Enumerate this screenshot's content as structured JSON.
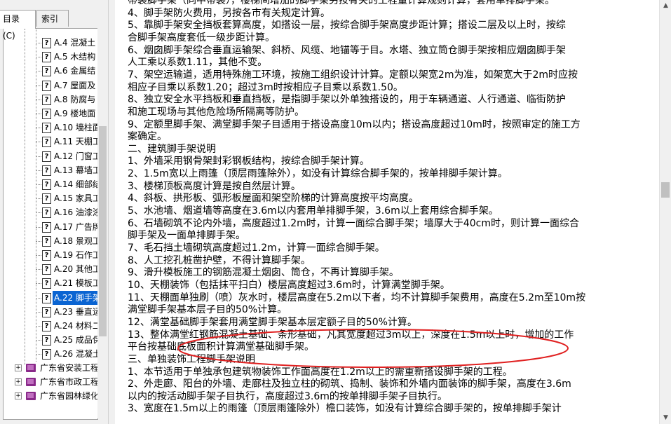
{
  "sidebar": {
    "tabs": {
      "contents": "目录(C)",
      "index": "索引(I)"
    },
    "items": [
      {
        "label": "A.4  混凝土"
      },
      {
        "label": "A.5  木结构"
      },
      {
        "label": "A.6  金属结"
      },
      {
        "label": "A.7  屋面及"
      },
      {
        "label": "A.8  防腐与"
      },
      {
        "label": "A.9  楼地面"
      },
      {
        "label": "A.10  墙柱面"
      },
      {
        "label": "A.11  天棚工"
      },
      {
        "label": "A.12  门窗工"
      },
      {
        "label": "A.13  幕墙工"
      },
      {
        "label": "A.14  细部结"
      },
      {
        "label": "A.15  家具工"
      },
      {
        "label": "A.16  油漆涂"
      },
      {
        "label": "A.17  广告牌"
      },
      {
        "label": "A.18  景观工"
      },
      {
        "label": "A.19  石作工"
      },
      {
        "label": "A.20  其他工"
      },
      {
        "label": "A.21  模板工"
      },
      {
        "label": "A.22  脚手架"
      },
      {
        "label": "A.23  垂直运"
      },
      {
        "label": "A.24  材料二"
      },
      {
        "label": "A.25  成品保"
      },
      {
        "label": "A.26  混凝土"
      }
    ],
    "books": [
      {
        "label": "广东省安装工程"
      },
      {
        "label": "广东省市政工程"
      },
      {
        "label": "广东省园林绿化"
      }
    ]
  },
  "content": {
    "lines": [
      "帯装脚手架（同中帯装），楼梯间增加的脚手架另按有关的工程量计算规则计算，套用单排脚手架。",
      "    4、脚手架防火费用，另按各市有关规定计算。",
      "    5、靠脚手架安全挡板套算高度，如搭设一层，按综合脚手架高度步距计算；搭设二层及以上时，按综",
      "合脚手架高度套低一级步距计算。",
      "    6、烟囱脚手架综合垂直运输架、斜桥、风缆、地锚等于目。水塔、独立筒仓脚手架按相应烟囱脚手架",
      "人工乘以系数1.11，其他不变。",
      "    7、架空运输道，适用特殊施工环境，按施工组织设计计算。定额以架宽2m为准，如架宽大于2m时应按",
      "相应子目乘以系数1.20；超过3m时按相应子目乘以系数1.50。",
      "    8、独立安全水平挡板和垂直挡板，是指脚手架以外单独搭设的，用于车辆通道、人行通道、临街防护",
      "和施工现场与其他危险场所隔离等防护。",
      "    9、定额里脚手架、满堂脚手架子目适用于搭设高度10m以内；搭设高度超过10m时，按照审定的施工方",
      "案确定。",
      "    二、建筑脚手架说明",
      "    1、外墙采用钢骨架封彩钢板结构，按综合脚手架计算。",
      "    2、1.5m宽以上雨篷（顶层雨篷除外），如没有计算综合脚手架的，按单排脚手架计算。",
      "    3、楼梯顶板高度计算是按自然层计算。",
      "    4、斜板、拱形板、弧形板屋面和架空阶梯的计算高度按平均高度。",
      "    5、水池墙、烟道墙等高度在3.6m以内套用单排脚手架，3.6m以上套用综合脚手架。",
      "    6、石墙砌筑不论内外墙，高度超过1.2m时，计算一面综合脚手架；墙厚大于40cm时，则计算一面综合",
      "脚手架及一面单排脚手架。",
      "    7、毛石挡土墙砌筑高度超过1.2m，计算一面综合脚手架。",
      "    8、人工挖孔桩凿护壁，不得计算脚手架。",
      "    9、滑升模板施工的钢筋混凝土烟囱、筒仓，不再计算脚手架。",
      "    10、天棚装饰（包括抹平扫白）楼层高度超过3.6m时，计算满堂脚手架。",
      "    11、天棚面单独刷（喷）灰水时，楼层高度在5.2m以下者，均不计算脚手架费用，高度在5.2m至10m按",
      "满堂脚手架基本层子目的50%计算。",
      "    12、满堂基础脚手架套用满堂脚手架基本层定额子目的50%计算。",
      "    13、整体满堂红钢筋混凝土基础、条形基础，凡其宽度超过3m以上，深度在1.5m以上时，增加的工作",
      "平台按基础底板面积计算满堂基础脚手架。",
      "    三、单独装饰工程脚手架说明",
      "    1、本节适用于单独承包建筑物装饰工作面高度在1.2m以上的需重新搭设脚手架的工程。",
      "    2、外走廊、阳台的外墙、走廊柱及独立柱的砌筑、捣制、装饰和外墙内面装饰的脚手架，高度在3.6m",
      "以内的按活动脚手架子目执行，高度超过3.6m的按单排脚手架子目执行。",
      "    3、宽度在1.5m以上的雨篷（顶层雨篷除外）檐口装饰，如没有计算综合脚手架的，按单排脚手架计"
    ]
  },
  "annotation": {
    "color": "#e02020"
  }
}
